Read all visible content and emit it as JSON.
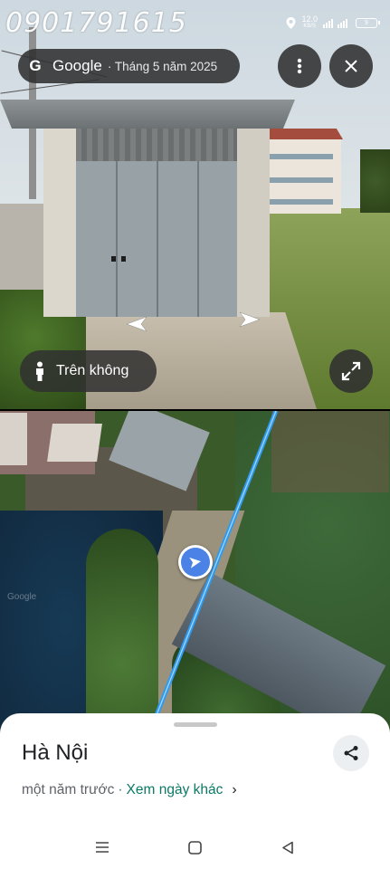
{
  "watermark": {
    "text": "0901791615"
  },
  "status_bar": {
    "speed_value": "12.0",
    "speed_unit": "KB/S",
    "battery": "9",
    "network": "4G"
  },
  "header": {
    "brand": "Google",
    "capture_date": "· Tháng 5 năm 2025",
    "google_logo": "G"
  },
  "icons": {
    "more": "more-vert-icon",
    "close": "close-icon",
    "pegman": "pegman-icon",
    "expand": "expand-icon",
    "share": "share-icon",
    "location": "navigation-arrow-icon"
  },
  "street_view": {
    "overlay_label": "Trên không"
  },
  "bottom_sheet": {
    "place_name": "Hà Nội",
    "time_ago": "một năm trước",
    "separator": "·",
    "other_dates_link": "Xem ngày khác"
  },
  "map": {
    "watermark": "Google"
  },
  "colors": {
    "accent_blue": "#4a82e6",
    "link_teal": "#0b7a66",
    "route_blue": "#2e9bf0"
  }
}
